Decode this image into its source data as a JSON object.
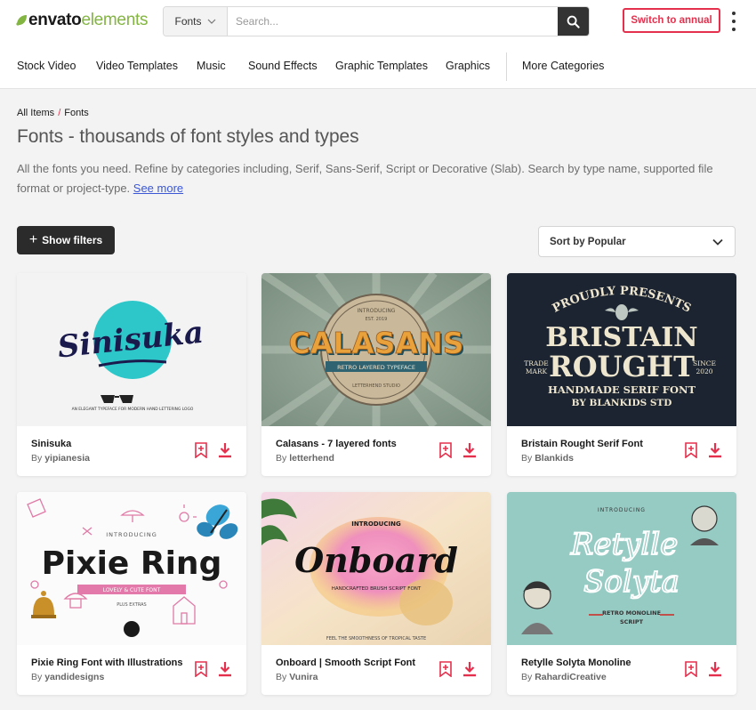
{
  "header": {
    "logo": {
      "part1": "envato",
      "part2": "elements"
    },
    "search": {
      "category": "Fonts",
      "placeholder": "Search..."
    },
    "switch_label": "Switch to annual",
    "nav": [
      "Stock Video",
      "Video Templates",
      "Music",
      "Sound Effects",
      "Graphic Templates",
      "Graphics",
      "More Categories"
    ]
  },
  "breadcrumb": {
    "root": "All Items",
    "sep": "/",
    "current": "Fonts"
  },
  "page": {
    "title": "Fonts - thousands of font styles and types",
    "description": "All the fonts you need. Refine by categories including, Serif, Sans-Serif, Script or Decorative (Slab). Search by type name, supported file format or project-type.",
    "see_more": "See more"
  },
  "controls": {
    "show_filters": "Show filters",
    "sort": "Sort by Popular"
  },
  "colors": {
    "accent": "#e5304d",
    "brand_green": "#82b541",
    "dark": "#2b2b2b"
  },
  "cards": [
    {
      "title": "Sinisuka",
      "author_prefix": "By",
      "author": "yipianesia",
      "art": {
        "headline": "Sinisuka",
        "tagline": "AN ELEGANT TYPEFACE FOR MODERN HAND LETTERING LOGO"
      }
    },
    {
      "title": "Calasans - 7 layered fonts",
      "author_prefix": "By",
      "author": "letterhend",
      "art": {
        "top": "INTRODUCING",
        "year": "EST. 2019",
        "headline": "CALASANS",
        "ribbon": "RETRO LAYERED TYPEFACE",
        "bottom": "LETTERHEND STUDIO"
      }
    },
    {
      "title": "Bristain Rought Serif Font",
      "author_prefix": "By",
      "author": "Blankids",
      "art": {
        "arc": "PROUDLY PRESENTS",
        "line1": "BRISTAIN",
        "line2": "ROUGHT",
        "left1": "TRADE",
        "left2": "MARK",
        "right1": "SINCE",
        "right2": "2020",
        "sub1": "HANDMADE SERIF FONT",
        "sub2": "BY BLANKIDS STD"
      }
    },
    {
      "title": "Pixie Ring Font with Illustrations",
      "author_prefix": "By",
      "author": "yandidesigns",
      "art": {
        "top": "INTRODUCING",
        "headline": "Pixie Ring",
        "banner": "LOVELY & CUTE FONT",
        "extras": "PLUS EXTRAS"
      }
    },
    {
      "title": "Onboard | Smooth Script Font",
      "author_prefix": "By",
      "author": "Vunira",
      "art": {
        "top": "INTRODUCING",
        "headline": "Onboard",
        "sub": "HANDCRAFTED BRUSH SCRIPT FONT",
        "bottom": "FEEL THE SMOOTHNESS OF TROPICAL TASTE"
      }
    },
    {
      "title": "Retylle Solyta Monoline",
      "author_prefix": "By",
      "author": "RahardiCreative",
      "art": {
        "top": "INTRODUCING",
        "line1": "Retylle",
        "line2": "Solyta",
        "sub1": "RETRO MONOLINE",
        "sub2": "SCRIPT"
      }
    }
  ]
}
